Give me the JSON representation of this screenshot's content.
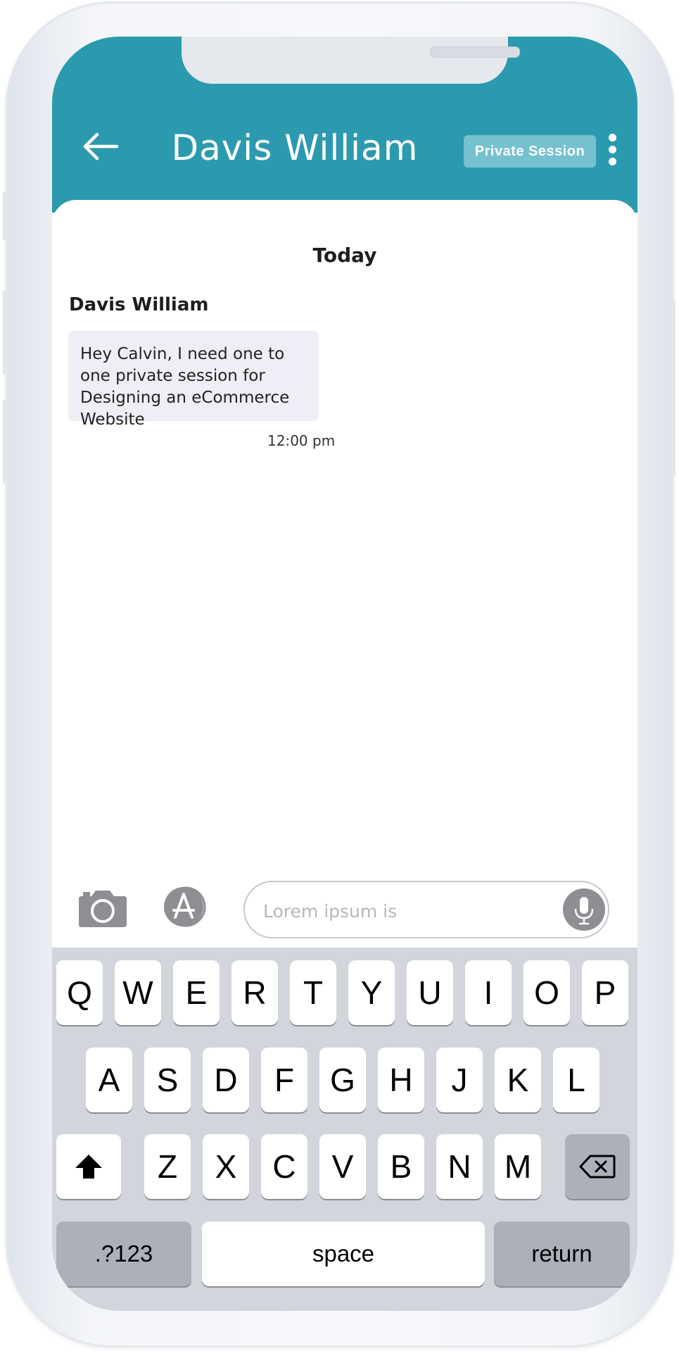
{
  "header": {
    "title": "Davis William",
    "private_session_label": "Private Session"
  },
  "chat": {
    "date_separator": "Today",
    "messages": [
      {
        "sender": "Davis William",
        "text": "Hey Calvin, I need one to one private session for Designing an eCommerce Website",
        "time": "12:00 pm"
      }
    ]
  },
  "composer": {
    "placeholder": "Lorem ipsum is",
    "icons": [
      "camera-icon",
      "app-store-icon",
      "microphone-icon"
    ]
  },
  "keyboard": {
    "row1": [
      "Q",
      "W",
      "E",
      "R",
      "T",
      "Y",
      "U",
      "I",
      "O",
      "P"
    ],
    "row2": [
      "A",
      "S",
      "D",
      "F",
      "G",
      "H",
      "J",
      "K",
      "L"
    ],
    "row3": [
      "Z",
      "X",
      "C",
      "V",
      "B",
      "N",
      "M"
    ],
    "numbers_label": ".?123",
    "space_label": "space",
    "return_label": "return",
    "icons": [
      "shift-icon",
      "backspace-icon"
    ]
  },
  "colors": {
    "header": "#2c9aae",
    "private_session_button": "#76c1cf",
    "bubble": "#eeeef7",
    "keyboard_bg": "#d2d5db"
  }
}
